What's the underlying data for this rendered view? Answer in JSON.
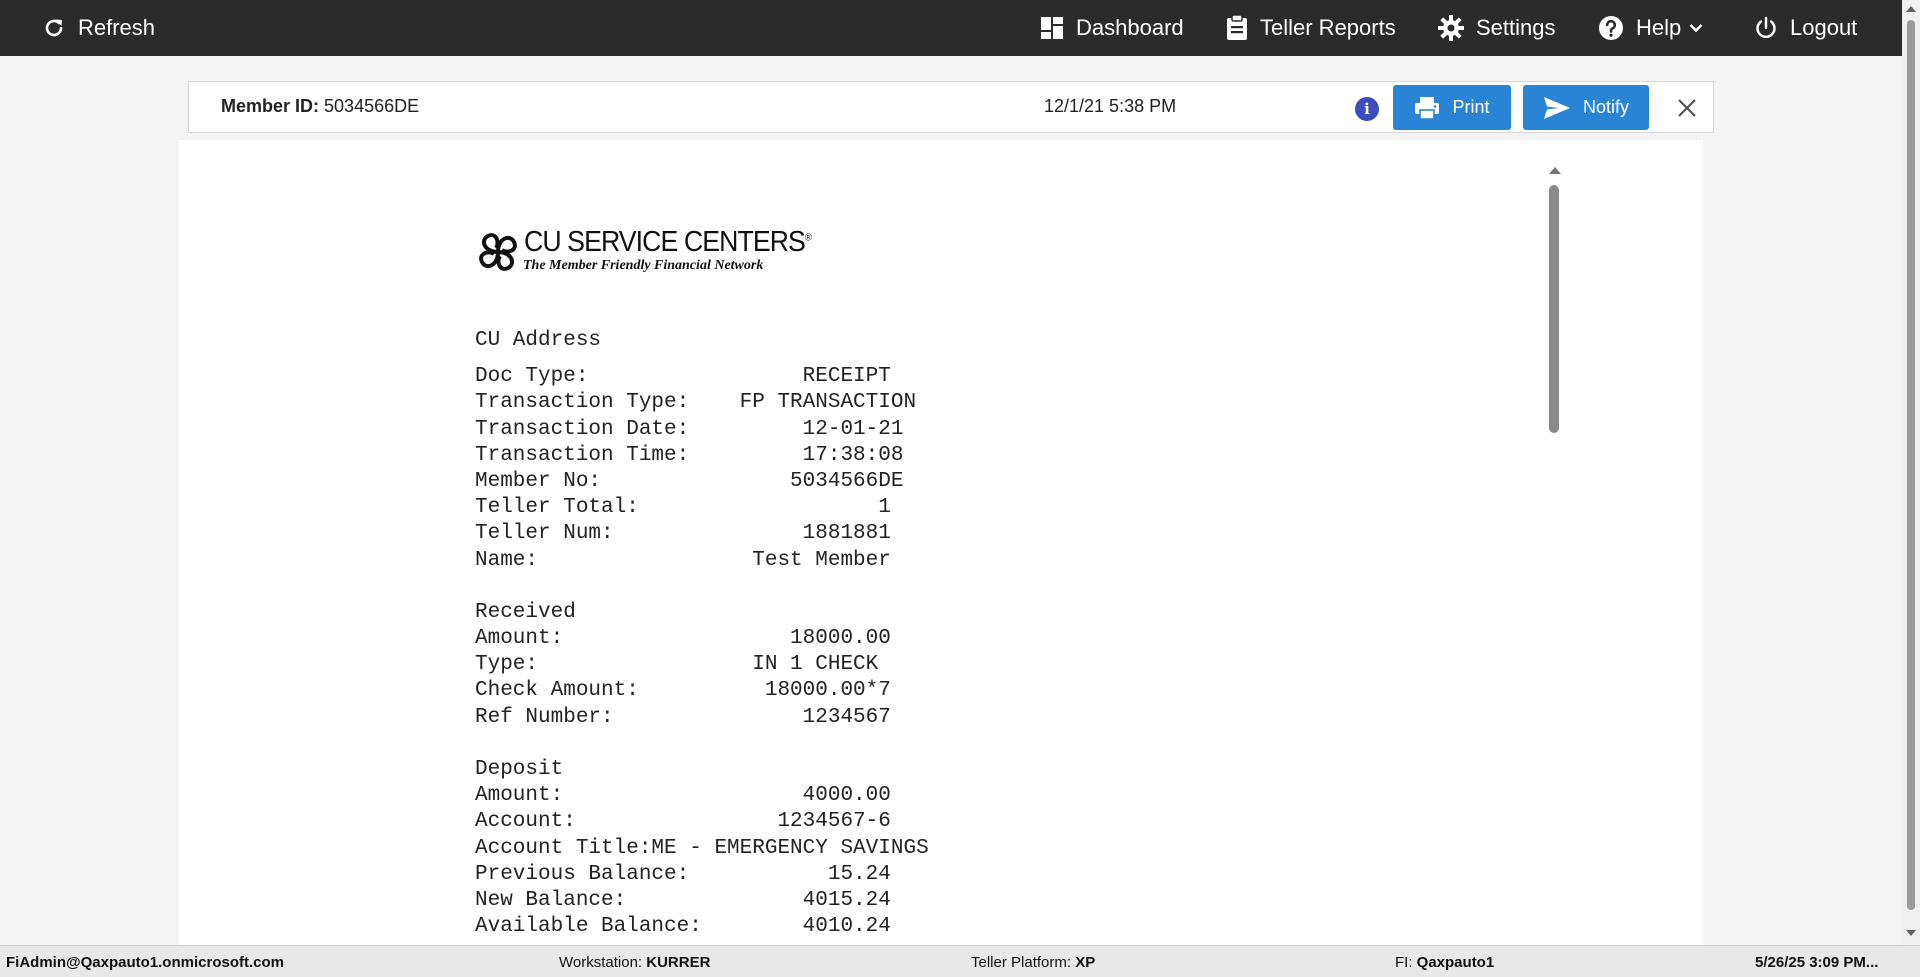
{
  "nav": {
    "refresh": "Refresh",
    "dashboard": "Dashboard",
    "teller_reports": "Teller Reports",
    "settings": "Settings",
    "help": "Help",
    "logout": "Logout",
    "icons": [
      "refresh-icon",
      "dashboard-icon",
      "clipboard-icon",
      "gear-icon",
      "help-icon",
      "chevron-down-icon",
      "power-icon"
    ]
  },
  "header": {
    "member_label": "Member ID:",
    "member_value": "5034566DE",
    "datetime": "12/1/21 5:38 PM",
    "print_label": "Print",
    "notify_label": "Notify"
  },
  "logo": {
    "name": "CU SERVICE CENTERS",
    "registered": "®",
    "tagline": "The Member Friendly Financial Network"
  },
  "receipt": {
    "lines": [
      "CU Address",
      "Doc Type:                 RECEIPT",
      "Transaction Type:    FP TRANSACTION",
      "Transaction Date:         12-01-21",
      "Transaction Time:         17:38:08",
      "Member No:               5034566DE",
      "Teller Total:                   1",
      "Teller Num:               1881881",
      "Name:                 Test Member",
      "",
      "Received",
      "Amount:                  18000.00",
      "Type:                 IN 1 CHECK",
      "Check Amount:          18000.00*7",
      "Ref Number:               1234567",
      "",
      "Deposit",
      "Amount:                   4000.00",
      "Account:                1234567-6",
      "Account Title:ME - EMERGENCY SAVINGS",
      "Previous Balance:           15.24",
      "New Balance:              4015.24",
      "Available Balance:        4010.24"
    ]
  },
  "status": {
    "user": "FiAdmin@Qaxpauto1.onmicrosoft.com",
    "workstation_label": "Workstation:",
    "workstation_value": "KURRER",
    "platform_label": "Teller Platform:",
    "platform_value": "XP",
    "fi_label": "FI:",
    "fi_value": "Qaxpauto1",
    "datetime": "5/26/25 3:09 PM..."
  },
  "colors": {
    "topbar": "#2b2b2b",
    "button": "#2a84d6",
    "info": "#3b4dbf",
    "statusbar": "#e8e8e8"
  }
}
